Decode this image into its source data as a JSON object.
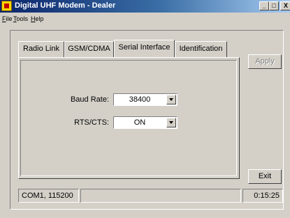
{
  "window": {
    "title": "Digital UHF Modem  -  Dealer",
    "minimize_glyph": "_",
    "maximize_glyph": "□",
    "close_glyph": "X"
  },
  "menu": {
    "items": [
      {
        "ul": "F",
        "rest": "ile"
      },
      {
        "ul": "T",
        "rest": "ools"
      },
      {
        "ul": "H",
        "rest": "elp"
      }
    ]
  },
  "tabs": [
    {
      "label": "Radio Link",
      "active": false
    },
    {
      "label": "GSM/CDMA",
      "active": false
    },
    {
      "label": "Serial Interface",
      "active": true
    },
    {
      "label": "Identification",
      "active": false
    }
  ],
  "serial": {
    "baud_rate_label": "Baud Rate:",
    "baud_rate_value": "38400",
    "rts_cts_label": "RTS/CTS:",
    "rts_cts_value": "ON"
  },
  "buttons": {
    "apply": "Apply",
    "exit": "Exit"
  },
  "status": {
    "port": "COM1, 115200",
    "middle": "",
    "time": "0:15:25"
  }
}
